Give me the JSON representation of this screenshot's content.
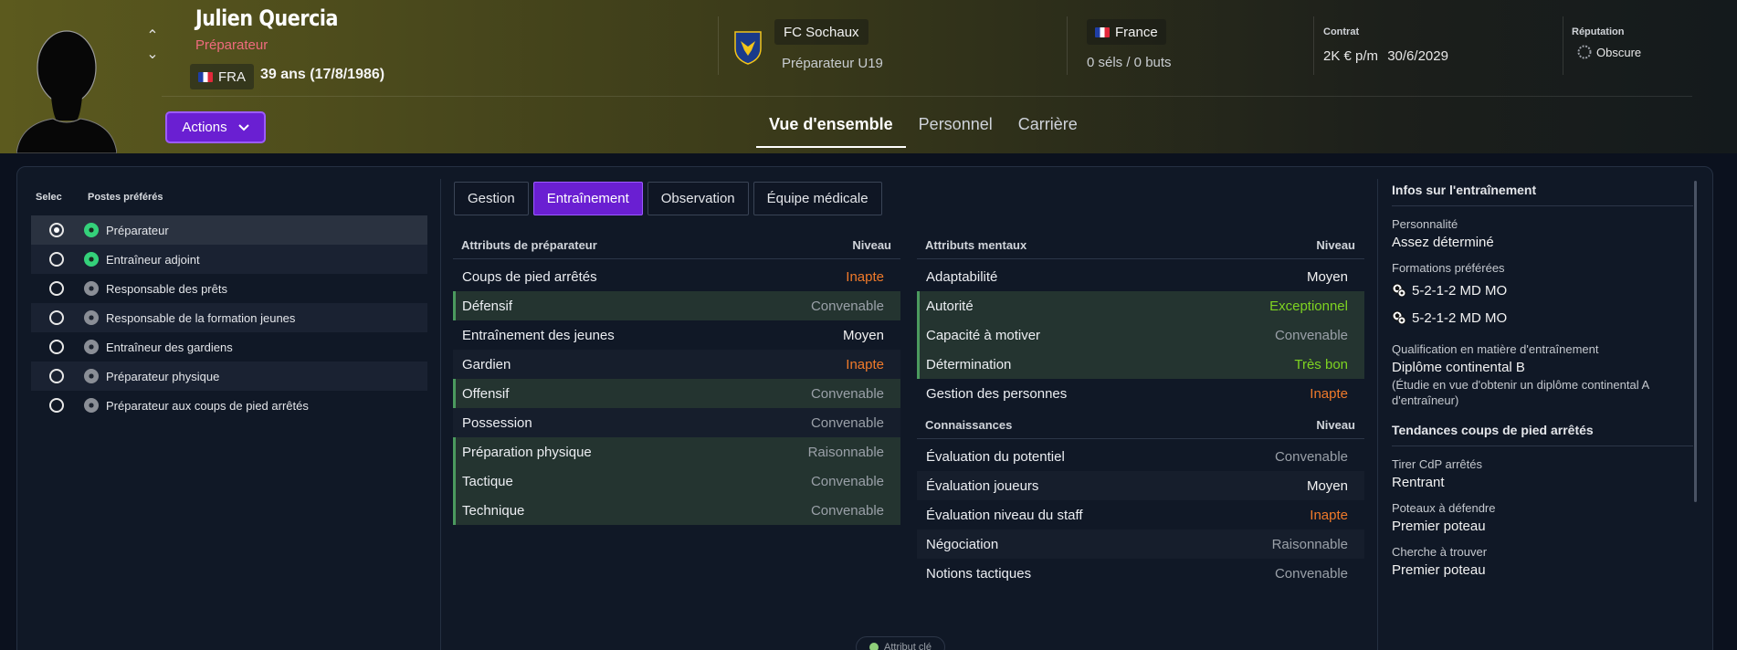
{
  "header": {
    "name": "Julien Quercia",
    "role": "Préparateur",
    "nationality_code": "FRA",
    "age": "39 ans (17/8/1986)",
    "actions_label": "Actions",
    "club": "FC Sochaux",
    "club_role": "Préparateur U19",
    "country": "France",
    "caps": "0 séls / 0 buts",
    "contract_label": "Contrat",
    "contract_wage": "2K € p/m",
    "contract_end": "30/6/2029",
    "reputation_label": "Réputation",
    "reputation_value": "Obscure"
  },
  "tabs": [
    "Vue d'ensemble",
    "Personnel",
    "Carrière"
  ],
  "positions": {
    "col_select": "Selec",
    "col_positions": "Postes préférés",
    "items": [
      {
        "label": "Préparateur",
        "icon": "green"
      },
      {
        "label": "Entraîneur adjoint",
        "icon": "green"
      },
      {
        "label": "Responsable des prêts",
        "icon": "grey"
      },
      {
        "label": "Responsable de la formation jeunes",
        "icon": "grey"
      },
      {
        "label": "Entraîneur des gardiens",
        "icon": "grey"
      },
      {
        "label": "Préparateur physique",
        "icon": "grey"
      },
      {
        "label": "Préparateur aux coups de pied arrêtés",
        "icon": "grey"
      }
    ]
  },
  "sub_tabs": [
    "Gestion",
    "Entraînement",
    "Observation",
    "Équipe médicale"
  ],
  "coach_attrs": {
    "title": "Attributs de préparateur",
    "level_label": "Niveau",
    "rows": [
      {
        "name": "Coups de pied arrêtés",
        "level": "Inapte"
      },
      {
        "name": "Défensif",
        "level": "Convenable"
      },
      {
        "name": "Entraînement des jeunes",
        "level": "Moyen"
      },
      {
        "name": "Gardien",
        "level": "Inapte"
      },
      {
        "name": "Offensif",
        "level": "Convenable"
      },
      {
        "name": "Possession",
        "level": "Convenable"
      },
      {
        "name": "Préparation physique",
        "level": "Raisonnable"
      },
      {
        "name": "Tactique",
        "level": "Convenable"
      },
      {
        "name": "Technique",
        "level": "Convenable"
      }
    ]
  },
  "mental_attrs": {
    "title": "Attributs mentaux",
    "level_label": "Niveau",
    "rows": [
      {
        "name": "Adaptabilité",
        "level": "Moyen"
      },
      {
        "name": "Autorité",
        "level": "Exceptionnel"
      },
      {
        "name": "Capacité à motiver",
        "level": "Convenable"
      },
      {
        "name": "Détermination",
        "level": "Très bon"
      },
      {
        "name": "Gestion des personnes",
        "level": "Inapte"
      }
    ]
  },
  "knowledge_attrs": {
    "title": "Connaissances",
    "level_label": "Niveau",
    "rows": [
      {
        "name": "Évaluation du potentiel",
        "level": "Convenable"
      },
      {
        "name": "Évaluation joueurs",
        "level": "Moyen"
      },
      {
        "name": "Évaluation niveau du staff",
        "level": "Inapte"
      },
      {
        "name": "Négociation",
        "level": "Raisonnable"
      },
      {
        "name": "Notions tactiques",
        "level": "Convenable"
      }
    ]
  },
  "legend": "Attribut clé",
  "training_info": {
    "title": "Infos sur l'entraînement",
    "personality_label": "Personnalité",
    "personality": "Assez déterminé",
    "formations_label": "Formations préférées",
    "formations": [
      "5-2-1-2 MD MO",
      "5-2-1-2 MD MO"
    ],
    "qualification_label": "Qualification en matière d'entraînement",
    "qualification": "Diplôme continental B",
    "qualification_note": "(Étudie en vue d'obtenir un diplôme continental A d'entraîneur)",
    "setpiece_title": "Tendances coups de pied arrêtés",
    "take_label": "Tirer CdP arrêtés",
    "take_value": "Rentrant",
    "defend_label": "Poteaux à défendre",
    "defend_value": "Premier poteau",
    "find_label": "Cherche à trouver",
    "find_value": "Premier poteau"
  },
  "colors": {
    "accent": "#6a1fd2",
    "inapte": "#f07a2a",
    "excellent": "#7ed321",
    "role": "#ef6b7e"
  }
}
